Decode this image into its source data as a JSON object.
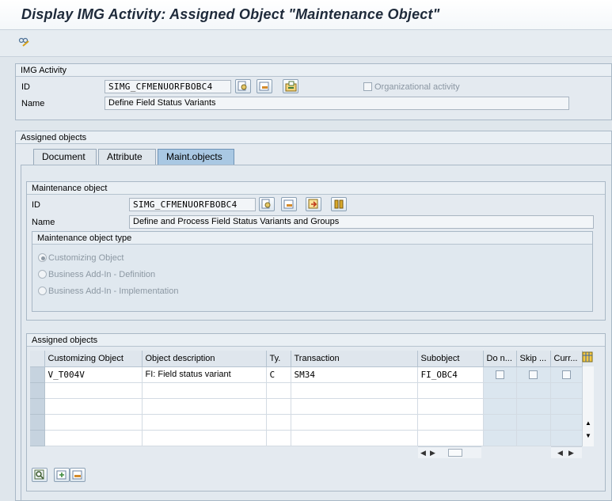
{
  "window": {
    "title": "Display IMG Activity: Assigned Object \"Maintenance Object\""
  },
  "toolbar": {
    "other_object_icon": "glasses-icon"
  },
  "img_activity": {
    "header": "IMG Activity",
    "id_label": "ID",
    "id_value": "SIMG_CFMENUORFBOBC4",
    "name_label": "Name",
    "name_value": "Define Field Status Variants",
    "org_activity_label": "Organizational activity"
  },
  "assigned_objects_group": {
    "header": "Assigned objects"
  },
  "tabs": [
    {
      "label": "Document"
    },
    {
      "label": "Attribute"
    },
    {
      "label": "Maint.objects"
    }
  ],
  "maintenance_object": {
    "header": "Maintenance object",
    "id_label": "ID",
    "id_value": "SIMG_CFMENUORFBOBC4",
    "name_label": "Name",
    "name_value": "Define and Process Field Status Variants and Groups",
    "type_header": "Maintenance object type",
    "types": [
      {
        "label": "Customizing Object",
        "selected": true
      },
      {
        "label": "Business Add-In - Definition",
        "selected": false
      },
      {
        "label": "Business Add-In - Implementation",
        "selected": false
      }
    ]
  },
  "assigned_objects_table": {
    "header": "Assigned objects",
    "columns": [
      "Customizing Object",
      "Object description",
      "Ty.",
      "Transaction",
      "Subobject",
      "Do n...",
      "Skip ...",
      "Curr..."
    ],
    "rows": [
      {
        "object": "V_T004V",
        "description": "FI: Field status variant",
        "type": "C",
        "transaction": "SM34",
        "subobject": "FI_OBC4"
      }
    ]
  },
  "colors": {
    "active_tab": "#a9c8e3",
    "title_text": "#1e2a3a",
    "background": "#dfe6ec"
  }
}
